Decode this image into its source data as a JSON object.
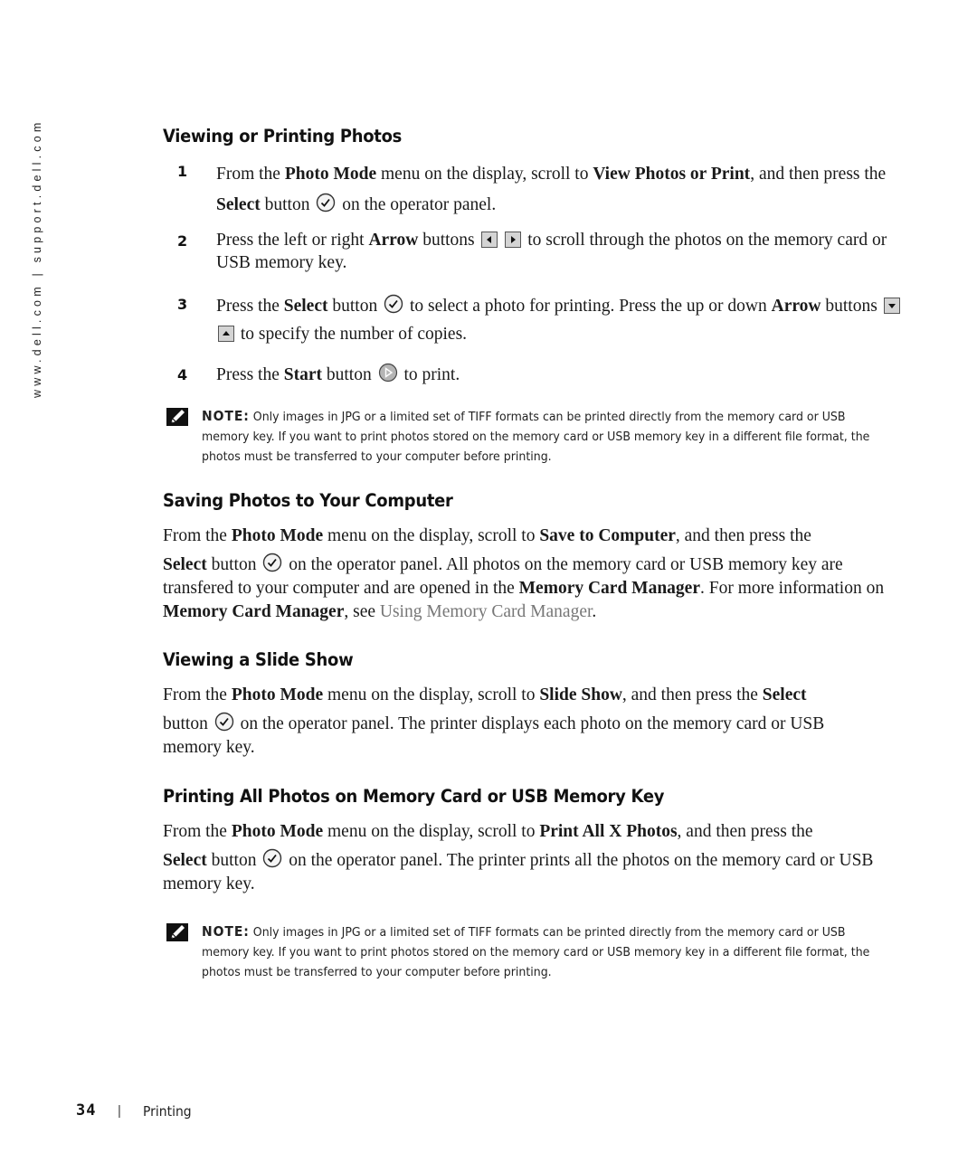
{
  "side_url": "www.dell.com | support.dell.com",
  "sections": {
    "viewing_printing": {
      "heading": "Viewing or Printing Photos",
      "steps": [
        {
          "num": "1",
          "t1": "From the ",
          "b1": "Photo Mode",
          "t2": " menu on the display, scroll to ",
          "b2": "View Photos or Print",
          "t3": ", and then press the ",
          "b3": "Select",
          "t4": " button",
          "t5": " on the operator panel.",
          "icon": "select-check-icon"
        },
        {
          "num": "2",
          "t1": "Press the left or right ",
          "b1": "Arrow",
          "t2": " buttons",
          "t3": " to scroll through the photos on the memory card or USB memory key.",
          "icons": [
            "left-arrow-button-icon",
            "right-arrow-button-icon"
          ]
        },
        {
          "num": "3",
          "t1": "Press the ",
          "b1": "Select",
          "t2": " button",
          "t3": " to select a photo for printing. Press the up or down ",
          "b2": "Arrow",
          "t4": " buttons",
          "t5": " to specify the number of copies.",
          "icons": [
            "select-check-icon",
            "down-arrow-button-icon",
            "up-arrow-button-icon"
          ]
        },
        {
          "num": "4",
          "t1": "Press the ",
          "b1": "Start",
          "t2": " button",
          "t3": " to print.",
          "icon": "start-play-icon"
        }
      ]
    },
    "note1": {
      "label": "NOTE:",
      "text": " Only images in JPG or a limited set of TIFF formats can be printed directly from the memory card or USB memory key. If you want to print photos stored on the memory card or USB memory key in a different file format, the photos must be transferred to your computer before printing."
    },
    "saving": {
      "heading": "Saving Photos to Your Computer",
      "t1": "From the ",
      "b1": "Photo Mode",
      "t2": " menu on the display, scroll to ",
      "b2": "Save to Computer",
      "t3": ", and then press the ",
      "b3": "Select",
      "t4": " button",
      "t5": " on the operator panel. All photos on the memory card or USB memory key are transfered to your computer and are opened in the ",
      "b4": "Memory Card Manager",
      "t6": ". For more information on ",
      "b5": "Memory Card Manager",
      "t7": ", see ",
      "link": "Using Memory Card Manager",
      "t8": "."
    },
    "slideshow": {
      "heading": "Viewing a Slide Show",
      "t1": "From the ",
      "b1": "Photo Mode",
      "t2": " menu on the display, scroll to ",
      "b2": "Slide Show",
      "t3": ", and then press the ",
      "b3": "Select",
      "t4": " button",
      "t5": " on the operator panel. The printer displays each photo on the memory card or USB memory key."
    },
    "print_all": {
      "heading": "Printing All Photos on Memory Card or USB Memory Key",
      "t1": "From the ",
      "b1": "Photo Mode",
      "t2": " menu on the display, scroll to ",
      "b2": "Print All X Photos",
      "t3": ", and then press the ",
      "b3": "Select",
      "t4": " button",
      "t5": " on the operator panel. The printer prints all the photos on the memory card or USB memory key."
    },
    "note2": {
      "label": "NOTE:",
      "text": " Only images in JPG or a limited set of TIFF formats can be printed directly from the memory card or USB memory key. If you want to print photos stored on the memory card or USB memory key in a different file format, the photos must be transferred to your computer before printing."
    }
  },
  "footer": {
    "page_number": "34",
    "separator": "|",
    "chapter": "Printing"
  }
}
